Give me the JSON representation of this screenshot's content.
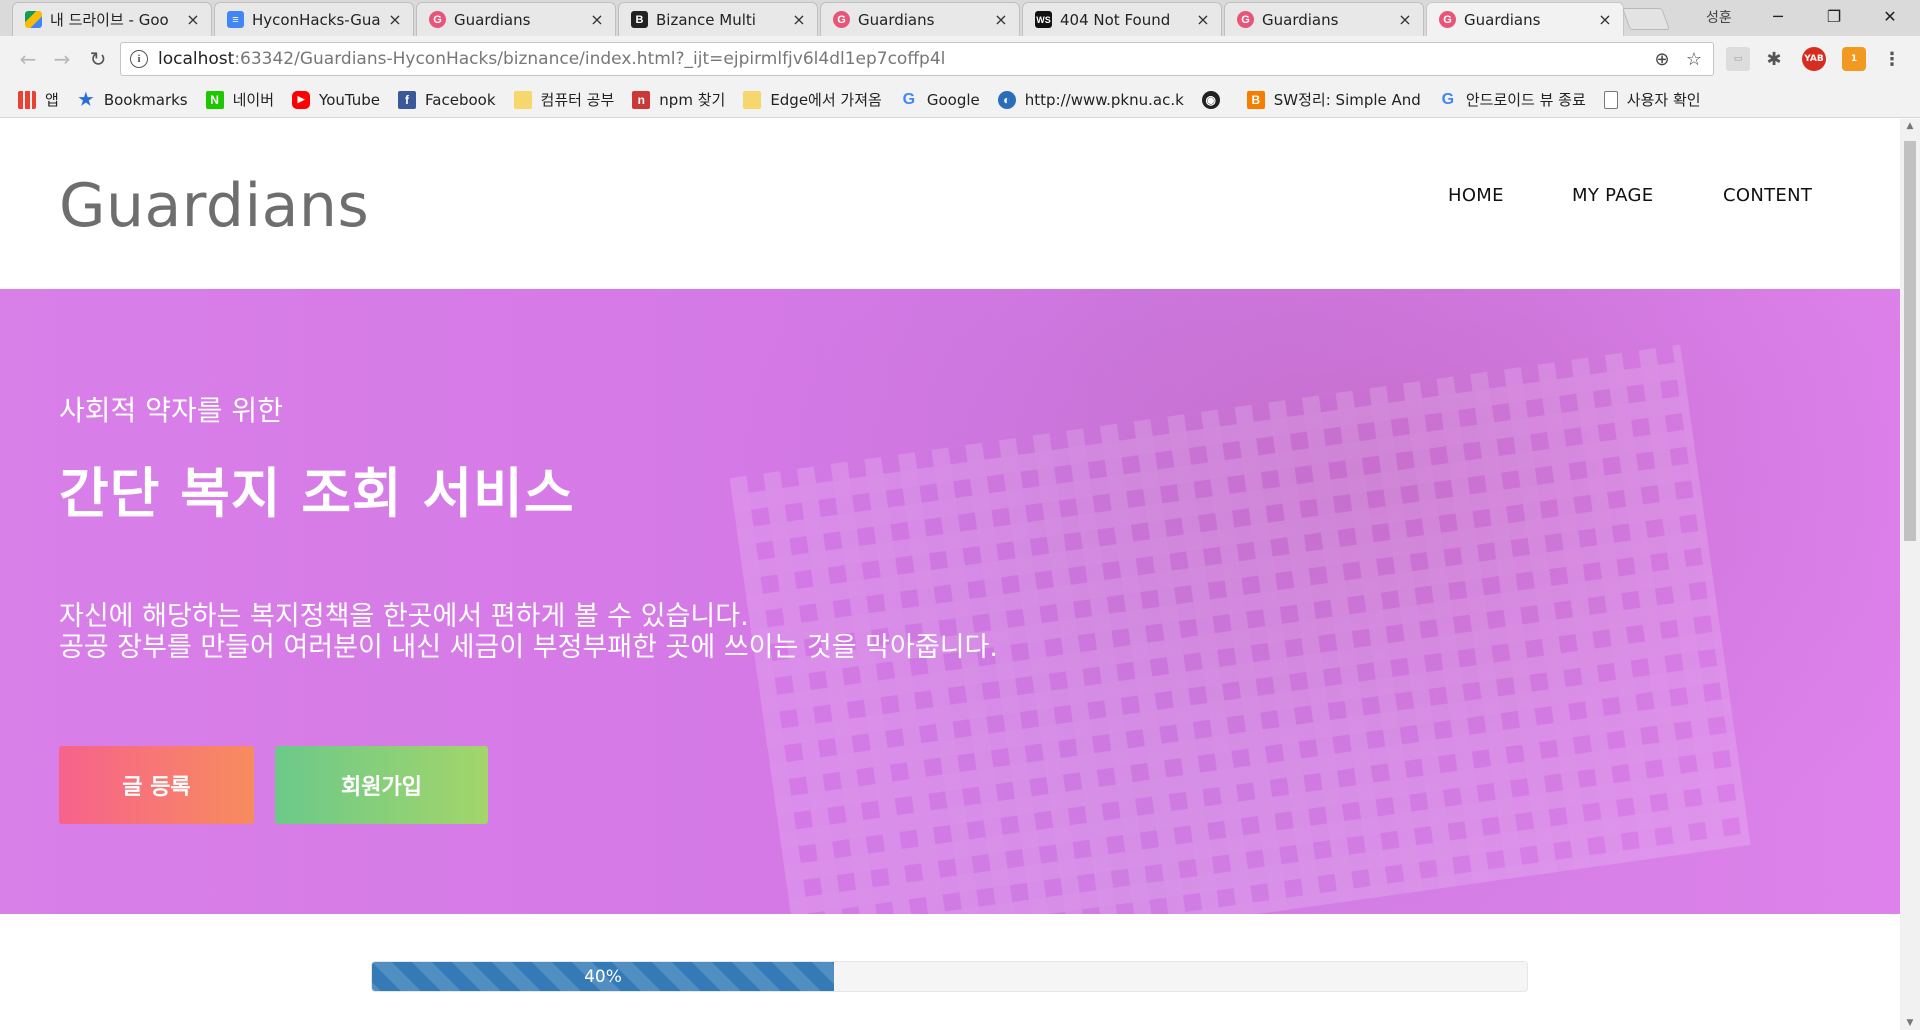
{
  "browser": {
    "tabs": [
      {
        "title": "내 드라이브 - Goo",
        "icon": "google-drive-icon",
        "color": "#1fa463"
      },
      {
        "title": "HyconHacks-Guard",
        "icon": "google-docs-icon",
        "color": "#4285f4"
      },
      {
        "title": "Guardians",
        "icon": "guardians-icon",
        "color": "#e8557a"
      },
      {
        "title": "Bizance Multi",
        "icon": "bizance-icon",
        "color": "#222222"
      },
      {
        "title": "Guardians",
        "icon": "guardians-icon",
        "color": "#e8557a"
      },
      {
        "title": "404 Not Found",
        "icon": "webstorm-icon",
        "color": "#111111"
      },
      {
        "title": "Guardians",
        "icon": "guardians-icon",
        "color": "#e8557a"
      },
      {
        "title": "Guardians",
        "icon": "guardians-icon",
        "color": "#e8557a"
      }
    ],
    "profile_label": "성훈",
    "url_host": "localhost",
    "url_rest": ":63342/Guardians-HyconHacks/biznance/index.html?_ijt=ejpirmlfjv6l4dl1ep7coffp4l",
    "bookmarks": [
      {
        "label": "앱",
        "icon": "apps-grid-icon"
      },
      {
        "label": "Bookmarks",
        "icon": "star-icon"
      },
      {
        "label": "네이버",
        "icon": "naver-icon",
        "color": "#1ec800"
      },
      {
        "label": "YouTube",
        "icon": "youtube-icon",
        "color": "#ff0000"
      },
      {
        "label": "Facebook",
        "icon": "facebook-icon",
        "color": "#3b5998"
      },
      {
        "label": "컴퓨터 공부",
        "icon": "folder-icon",
        "color": "#f5d76e"
      },
      {
        "label": "npm 찾기",
        "icon": "npm-icon",
        "color": "#cb3837"
      },
      {
        "label": "Edge에서 가져옴",
        "icon": "folder-icon",
        "color": "#f5d76e"
      },
      {
        "label": "Google",
        "icon": "google-icon"
      },
      {
        "label": "http://www.pknu.ac.k",
        "icon": "globe-icon"
      },
      {
        "label": "",
        "icon": "github-icon"
      },
      {
        "label": "SW정리: Simple And",
        "icon": "blogger-icon",
        "color": "#f57d00"
      },
      {
        "label": "안드로이드 뷰 종료",
        "icon": "google-icon"
      },
      {
        "label": "사용자 확인",
        "icon": "page-icon"
      }
    ]
  },
  "site": {
    "logo": "Guardians",
    "nav": [
      "HOME",
      "MY PAGE",
      "CONTENT"
    ],
    "hero": {
      "subtitle": "사회적 약자를 위한",
      "headline": "간단 복지 조회 서비스",
      "desc_line1": "자신에 해당하는 복지정책을 한곳에서 편하게 볼 수 있습니다.",
      "desc_line2": "공공 장부를 만들어 여러분이 내신 세금이 부정부패한 곳에 쓰이는 것을 막아줍니다."
    },
    "buttons": {
      "post": "글 등록",
      "signup": "회원가입"
    },
    "progress": {
      "label": "40%",
      "value": 40
    }
  },
  "colors": {
    "hero_overlay": "#d97fe8",
    "post_button_from": "#f7628c",
    "post_button_to": "#f78c5e",
    "signup_button_from": "#6cc98a",
    "signup_button_to": "#a3d56a",
    "progress": "#337ab7"
  }
}
